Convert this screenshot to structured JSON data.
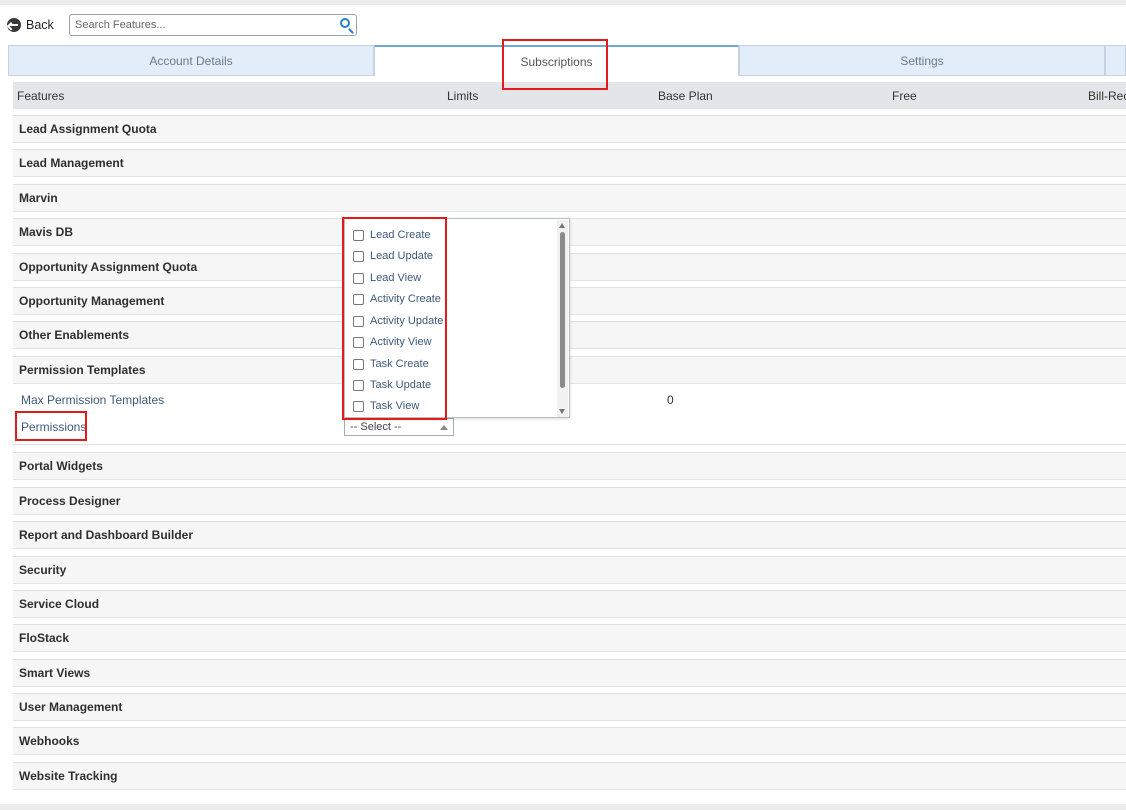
{
  "back": {
    "label": "Back"
  },
  "search": {
    "placeholder": "Search Features..."
  },
  "tabs": [
    {
      "label": "Account Details"
    },
    {
      "label": "Subscriptions"
    },
    {
      "label": "Settings"
    }
  ],
  "table": {
    "columns": [
      "Features",
      "Limits",
      "Base Plan",
      "Free",
      "Bill-Rec"
    ]
  },
  "features_before": [
    "Lead Assignment Quota",
    "Lead Management",
    "Marvin",
    "Mavis DB",
    "Opportunity Assignment Quota",
    "Opportunity Management",
    "Other Enablements",
    "Permission Templates"
  ],
  "permission_templates": {
    "max_label": "Max Permission Templates",
    "max_base_plan_value": "0",
    "permissions_label": "Permissions",
    "select_value": "-- Select --"
  },
  "permission_options": [
    "Lead Create",
    "Lead Update",
    "Lead View",
    "Activity Create",
    "Activity Update",
    "Activity View",
    "Task Create",
    "Task Update",
    "Task View"
  ],
  "features_after": [
    "Portal Widgets",
    "Process Designer",
    "Report and Dashboard Builder",
    "Security",
    "Service Cloud",
    "FloStack",
    "Smart Views",
    "User Management",
    "Webhooks",
    "Website Tracking"
  ],
  "colors": {
    "highlight": "#e41b1b",
    "tab_background": "#e3edf9",
    "active_tab_border": "#6fa8dc",
    "link": "#3d5a7a"
  },
  "icons": {
    "back": "back-arrow-circle-icon",
    "search": "search-icon"
  }
}
